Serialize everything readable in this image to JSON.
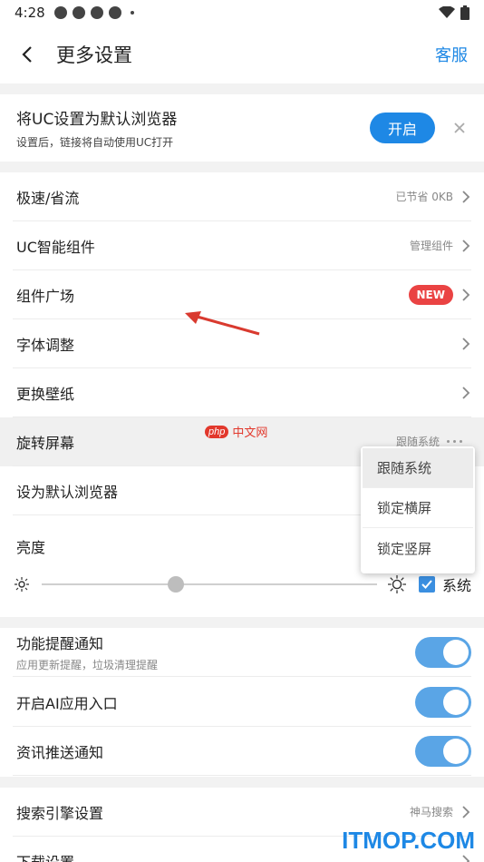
{
  "status_bar": {
    "time": "4:28"
  },
  "header": {
    "title": "更多设置",
    "service": "客服"
  },
  "banner": {
    "title": "将UC设置为默认浏览器",
    "subtitle": "设置后，链接将自动使用UC打开",
    "enable_label": "开启"
  },
  "rows": [
    {
      "label": "极速/省流",
      "value": "已节省 0KB"
    },
    {
      "label": "UC智能组件",
      "value": "管理组件"
    },
    {
      "label": "组件广场",
      "badge": "NEW"
    },
    {
      "label": "字体调整"
    },
    {
      "label": "更换壁纸"
    },
    {
      "label": "旋转屏幕",
      "value": "跟随系统"
    },
    {
      "label": "设为默认浏览器"
    }
  ],
  "popup": {
    "options": [
      "跟随系统",
      "锁定横屏",
      "锁定竖屏"
    ],
    "selected": "跟随系统"
  },
  "brightness": {
    "label": "亮度",
    "level": 0.4,
    "system_label": "系统",
    "system_checked": true
  },
  "toggles": [
    {
      "label": "功能提醒通知",
      "subtitle": "应用更新提醒，垃圾清理提醒",
      "on": true
    },
    {
      "label": "开启AI应用入口",
      "on": true
    },
    {
      "label": "资讯推送通知",
      "on": true
    }
  ],
  "bottom_rows": [
    {
      "label": "搜索引擎设置",
      "value": "神马搜索"
    },
    {
      "label": "下载设置"
    }
  ],
  "watermarks": {
    "php_badge": "php",
    "php_text": "中文网",
    "itmop": "ITMOP.COM"
  },
  "colors": {
    "accent": "#1e88e5",
    "badge": "#ea4343",
    "toggle": "#5aa5e6"
  }
}
